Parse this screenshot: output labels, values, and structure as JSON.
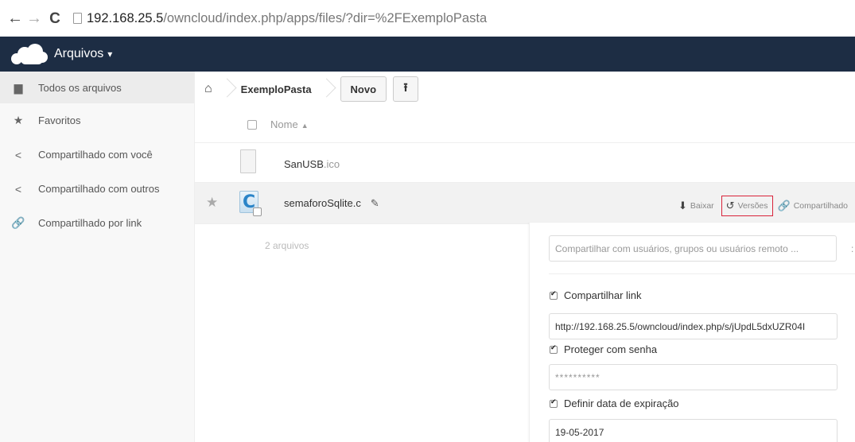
{
  "browser": {
    "back": "←",
    "forward": "→",
    "reload": "C",
    "url_host": "192.168.25.5",
    "url_path": "/owncloud/index.php/apps/files/?dir=%2FExemploPasta"
  },
  "header": {
    "app_name": "Arquivos",
    "caret": "▾"
  },
  "sidebar": {
    "items": [
      {
        "label": "Todos os arquivos",
        "icon": "folder-icon",
        "glyph": "▆"
      },
      {
        "label": "Favoritos",
        "icon": "star-icon",
        "glyph": "★"
      },
      {
        "label": "Compartilhado com você",
        "icon": "share-icon",
        "glyph": "<"
      },
      {
        "label": "Compartilhado com outros",
        "icon": "share-icon",
        "glyph": "<"
      },
      {
        "label": "Compartilhado por link",
        "icon": "link-icon",
        "glyph": "🔗"
      }
    ]
  },
  "controls": {
    "home_glyph": "⌂",
    "breadcrumb": "ExemploPasta",
    "new_button": "Novo",
    "upload_glyph": "⭱"
  },
  "list": {
    "name_header": "Nome",
    "sort_arrow": "▲",
    "files": [
      {
        "name": "SanUSB",
        "ext": ".ico"
      },
      {
        "name": "semaforoSqlite",
        "ext": ".c"
      }
    ],
    "summary": "2 arquivos"
  },
  "actions": {
    "download": "Baixar",
    "versions": "Versões",
    "share": "Compartilhado"
  },
  "share_panel": {
    "share_placeholder": "Compartilhar com usuários, grupos ou usuários remoto ...",
    "share_link_label": "Compartilhar link",
    "link_url": "http://192.168.25.5/owncloud/index.php/s/jUpdL5dxUZR04I",
    "password_label": "Proteger com senha",
    "password_value": "**********",
    "expiration_label": "Definir data de expiração",
    "expiration_date": "19-05-2017"
  },
  "colors": {
    "header_bg": "#1d2d44",
    "highlight_border": "#d9233a"
  }
}
